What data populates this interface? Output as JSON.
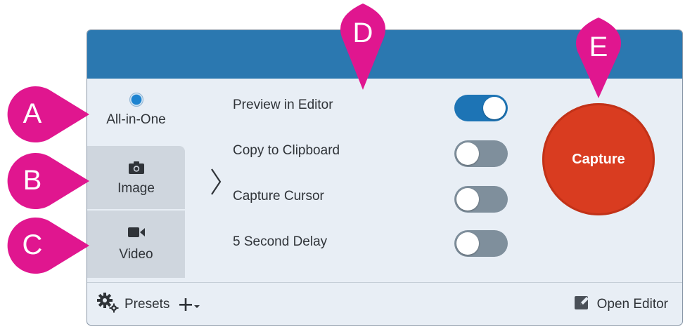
{
  "modes": {
    "all_in_one": "All-in-One",
    "image": "Image",
    "video": "Video"
  },
  "options": [
    {
      "label": "Preview in Editor",
      "enabled": true
    },
    {
      "label": "Copy to Clipboard",
      "enabled": false
    },
    {
      "label": "Capture Cursor",
      "enabled": false
    },
    {
      "label": "5 Second Delay",
      "enabled": false
    }
  ],
  "capture_label": "Capture",
  "footer": {
    "presets_label": "Presets",
    "open_editor_label": "Open Editor"
  },
  "callouts": [
    "A",
    "B",
    "C",
    "D",
    "E"
  ],
  "icons": {
    "image": "camera-icon",
    "video": "video-camera-icon",
    "presets": "gears-icon",
    "add": "plus-dropdown-icon",
    "open_editor": "pencil-edit-icon",
    "expand": "chevron-right-icon"
  },
  "colors": {
    "titlebar": "#2b78b0",
    "toggle_on": "#1d74b5",
    "toggle_off": "#7f8f9c",
    "capture": "#d93c20",
    "callout": "#e0168f"
  }
}
